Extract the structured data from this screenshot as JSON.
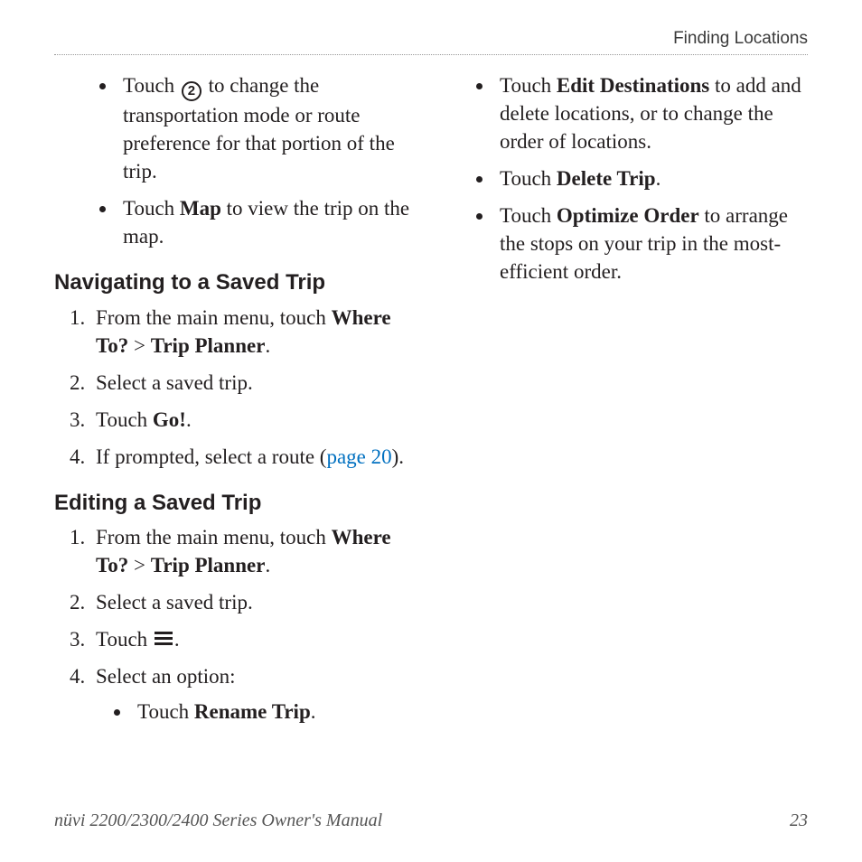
{
  "running_head": "Finding Locations",
  "left": {
    "intro_bullets": [
      {
        "pre": "Touch ",
        "icon": "circled-2",
        "post": " to change the transportation mode or route preference for that portion of the trip."
      },
      {
        "pre": "Touch ",
        "bold": "Map",
        "post": " to view the trip on the map."
      }
    ],
    "section1_head": "Navigating to a Saved Trip",
    "section1_steps": [
      {
        "text_pre": "From the main menu, touch ",
        "bold1": "Where To?",
        "sep": " > ",
        "bold2": "Trip Planner",
        "post": "."
      },
      {
        "text": "Select a saved trip."
      },
      {
        "text_pre": "Touch ",
        "bold1": "Go!",
        "post": "."
      },
      {
        "text_pre": "If prompted, select a route (",
        "link": "page 20",
        "post": ")."
      }
    ],
    "section2_head": "Editing a Saved Trip",
    "section2_steps": [
      {
        "text_pre": "From the main menu, touch ",
        "bold1": "Where To?",
        "sep": " > ",
        "bold2": "Trip Planner",
        "post": "."
      },
      {
        "text": "Select a saved trip."
      },
      {
        "text_pre": "Touch ",
        "icon": "menu",
        "post": "."
      },
      {
        "text": "Select an option:",
        "sub": [
          {
            "pre": "Touch ",
            "bold": "Rename Trip",
            "post": "."
          }
        ]
      }
    ]
  },
  "right": {
    "bullets": [
      {
        "pre": "Touch ",
        "bold": "Edit Destinations",
        "post": " to add and delete locations, or to change the order of locations."
      },
      {
        "pre": "Touch ",
        "bold": "Delete Trip",
        "post": "."
      },
      {
        "pre": "Touch ",
        "bold": "Optimize Order",
        "post": " to arrange the stops on your trip in the most-efficient order."
      }
    ]
  },
  "footer_left": "nüvi 2200/2300/2400 Series Owner's Manual",
  "footer_right": "23"
}
